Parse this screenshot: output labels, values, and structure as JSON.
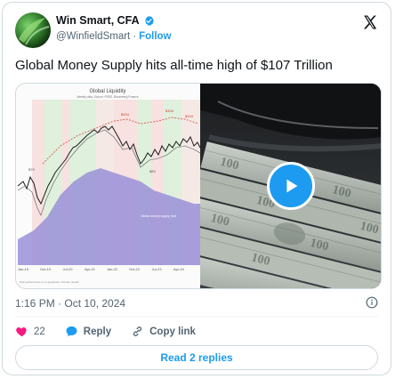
{
  "author": {
    "name": "Win Smart, CFA",
    "handle": "@WinfieldSmart",
    "separator": "·",
    "follow_label": "Follow"
  },
  "tweet": {
    "text": "Global Money Supply hits all-time high of $107 Trillion",
    "timestamp": "1:16 PM · Oct 10, 2024"
  },
  "media_chart": {
    "title": "Global Liquidity",
    "subtitle": "Weekly data, Source: FRED, Bloomberg Finance",
    "peak_labels": [
      "$104",
      "$104",
      "$104"
    ],
    "low_labels": [
      "$79",
      "$83"
    ],
    "x_ticks": [
      "Jan-19",
      "Oct-19",
      "Jul-20",
      "Apr-21",
      "Jan-22",
      "Oct-22",
      "Jul-23",
      "Apr-24"
    ],
    "legend_text": "Global money supply (trn)",
    "footer": "Past performance is no guarantee of future results"
  },
  "actions": {
    "like_count": "22",
    "reply_label": "Reply",
    "copy_label": "Copy link"
  },
  "read_replies_label": "Read 2 replies",
  "colors": {
    "accent": "#1d9bf0",
    "like": "#f91880",
    "text": "#0f1419",
    "muted": "#536471",
    "border": "#cfd9de"
  },
  "icons": [
    "verified-badge-icon",
    "x-logo-icon",
    "play-icon",
    "heart-icon",
    "reply-bubble-icon",
    "link-icon",
    "info-icon"
  ]
}
